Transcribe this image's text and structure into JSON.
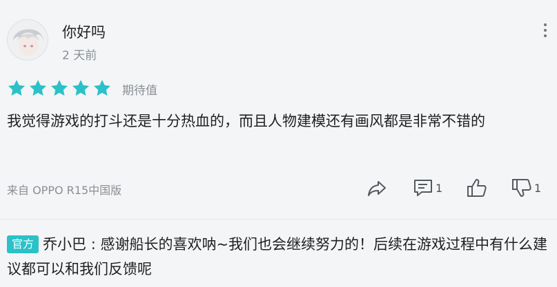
{
  "user": {
    "name": "你好吗",
    "time": "2 天前"
  },
  "rating": {
    "stars": 5,
    "max": 5,
    "label": "期待值",
    "color": "#2bc1c8"
  },
  "review": {
    "text": "我觉得游戏的打斗还是十分热血的，而且人物建模还有画风都是非常不错的"
  },
  "device": {
    "text": "来自 OPPO R15中国版"
  },
  "actions": {
    "share_icon": "share-icon",
    "comment_icon": "comment-icon",
    "comment_count": "1",
    "like_icon": "thumbs-up-icon",
    "dislike_icon": "thumbs-down-icon",
    "dislike_count": "1"
  },
  "official_reply": {
    "badge": "官方",
    "author": "乔小巴",
    "separator": " : ",
    "text": "感谢船长的喜欢呐~我们也会继续努力的！后续在游戏过程中有什么建议都可以和我们反馈呢"
  }
}
